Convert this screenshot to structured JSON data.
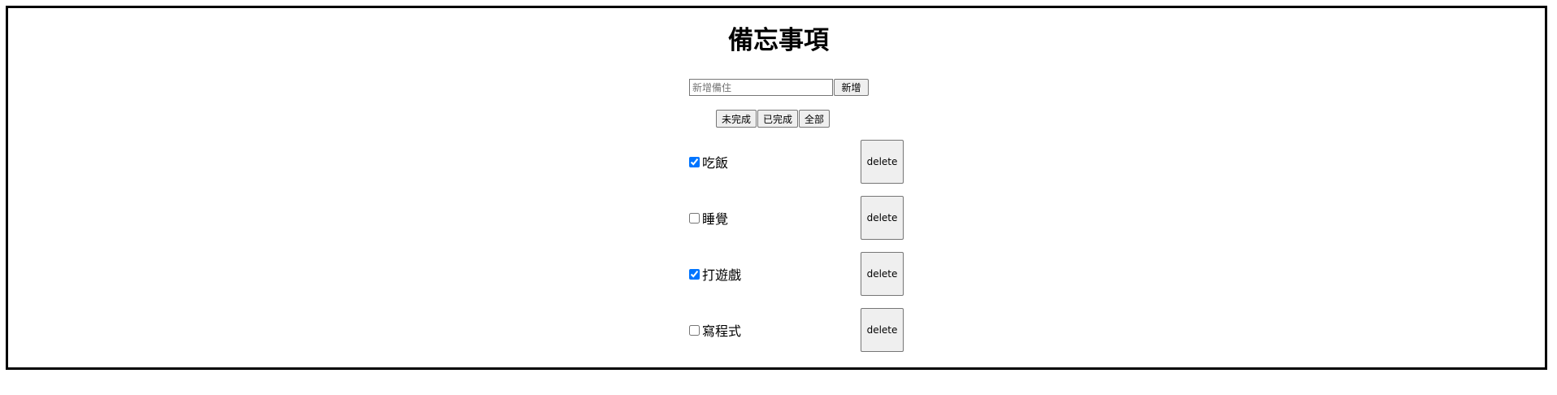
{
  "app": {
    "title": "備忘事項"
  },
  "add": {
    "placeholder": "新增備住",
    "value": "",
    "button_label": "新增"
  },
  "filters": [
    {
      "label": "未完成"
    },
    {
      "label": "已完成"
    },
    {
      "label": "全部"
    }
  ],
  "todos": [
    {
      "text": "吃飯",
      "done": true,
      "delete_label": "delete"
    },
    {
      "text": "睡覺",
      "done": false,
      "delete_label": "delete"
    },
    {
      "text": "打遊戲",
      "done": true,
      "delete_label": "delete"
    },
    {
      "text": "寫程式",
      "done": false,
      "delete_label": "delete"
    }
  ],
  "colors": {
    "frame_border": "#000000",
    "button_bg": "#efefef",
    "checkbox_accent": "#0075ff"
  }
}
